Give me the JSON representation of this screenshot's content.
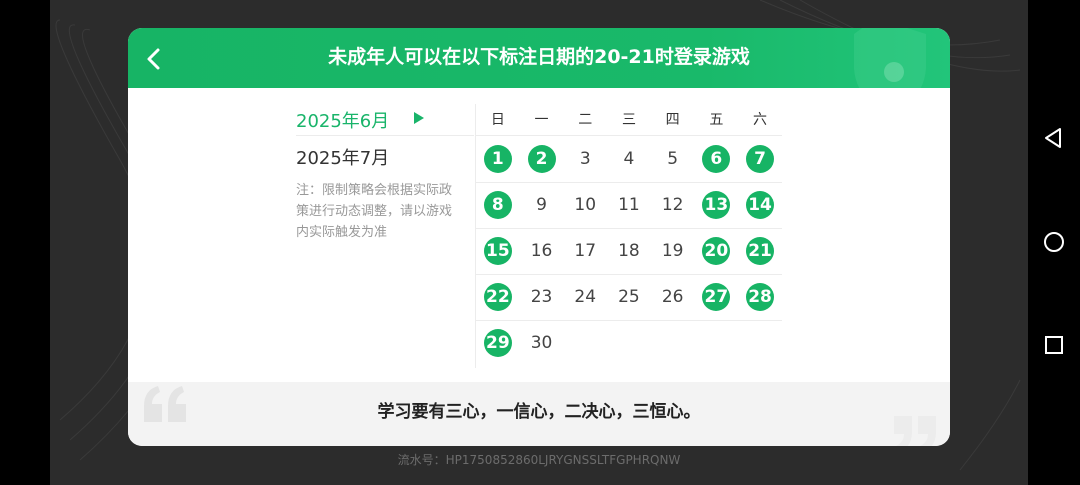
{
  "header": {
    "title": "未成年人可以在以下标注日期的20-21时登录游戏"
  },
  "months": {
    "current": "2025年6月",
    "next": "2025年7月"
  },
  "note": "注：限制策略会根据实际政策进行动态调整，请以游戏内实际触发为准",
  "calendar": {
    "weekdays": [
      "日",
      "一",
      "二",
      "三",
      "四",
      "五",
      "六"
    ],
    "days": [
      {
        "label": "1",
        "allowed": true
      },
      {
        "label": "2",
        "allowed": true
      },
      {
        "label": "3",
        "allowed": false
      },
      {
        "label": "4",
        "allowed": false
      },
      {
        "label": "5",
        "allowed": false
      },
      {
        "label": "6",
        "allowed": true
      },
      {
        "label": "7",
        "allowed": true
      },
      {
        "label": "8",
        "allowed": true
      },
      {
        "label": "9",
        "allowed": false
      },
      {
        "label": "10",
        "allowed": false
      },
      {
        "label": "11",
        "allowed": false
      },
      {
        "label": "12",
        "allowed": false
      },
      {
        "label": "13",
        "allowed": true
      },
      {
        "label": "14",
        "allowed": true
      },
      {
        "label": "15",
        "allowed": true
      },
      {
        "label": "16",
        "allowed": false
      },
      {
        "label": "17",
        "allowed": false
      },
      {
        "label": "18",
        "allowed": false
      },
      {
        "label": "19",
        "allowed": false
      },
      {
        "label": "20",
        "allowed": true
      },
      {
        "label": "21",
        "allowed": true
      },
      {
        "label": "22",
        "allowed": true
      },
      {
        "label": "23",
        "allowed": false
      },
      {
        "label": "24",
        "allowed": false
      },
      {
        "label": "25",
        "allowed": false
      },
      {
        "label": "26",
        "allowed": false
      },
      {
        "label": "27",
        "allowed": true
      },
      {
        "label": "28",
        "allowed": true
      },
      {
        "label": "29",
        "allowed": true
      },
      {
        "label": "30",
        "allowed": false
      }
    ]
  },
  "quote": "学习要有三心，一信心，二决心，三恒心。",
  "serial": "流水号：HP1750852860LJRYGNSSLTFGPHRQNW",
  "colors": {
    "accent": "#17b465",
    "background": "#2c2c2c"
  },
  "icons": {
    "back": "chevron-left-icon",
    "month_arrow": "play-triangle-icon",
    "nav_back": "triangle-back-icon",
    "nav_home": "circle-home-icon",
    "nav_recents": "square-recents-icon"
  }
}
